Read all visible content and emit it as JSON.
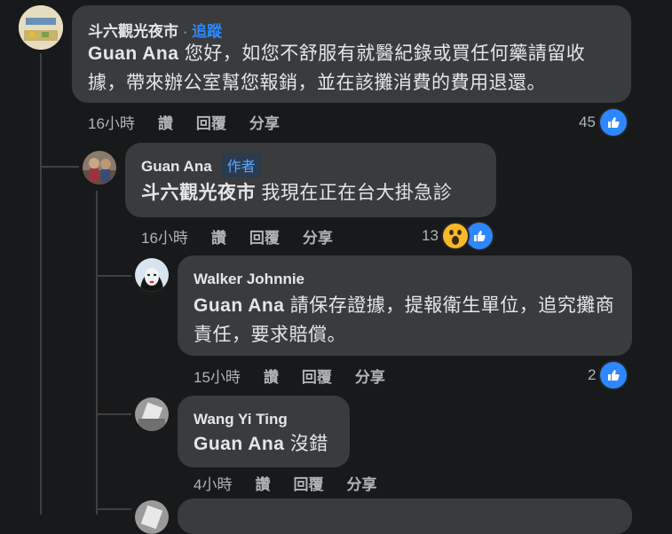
{
  "comments": [
    {
      "name": "斗六觀光夜市",
      "separator": " · ",
      "follow": "追蹤",
      "mention": "Guan Ana",
      "text": " 您好，如您不舒服有就醫紀錄或買任何藥請留收據，帶來辦公室幫您報銷，並在該攤消費的費用退還。",
      "time": "16小時",
      "read": "讚",
      "reply": "回覆",
      "share": "分享",
      "reactions": "45"
    },
    {
      "name": "Guan Ana",
      "badge": "作者",
      "mention": "斗六觀光夜市",
      "text": " 我現在正在台大掛急診",
      "time": "16小時",
      "read": "讚",
      "reply": "回覆",
      "share": "分享",
      "reactions": "13"
    },
    {
      "name": "Walker Johnnie",
      "mention": "Guan Ana",
      "text": " 請保存證據，提報衛生單位，追究攤商責任，要求賠償。",
      "time": "15小時",
      "read": "讚",
      "reply": "回覆",
      "share": "分享",
      "reactions": "2"
    },
    {
      "name": "Wang Yi Ting",
      "mention": "Guan Ana",
      "text": " 沒錯",
      "time": "4小時",
      "read": "讚",
      "reply": "回覆",
      "share": "分享"
    }
  ],
  "colors": {
    "background": "#18191a",
    "bubble": "#3a3b3c",
    "link": "#2d88ff",
    "meta": "#b0b3b8"
  }
}
